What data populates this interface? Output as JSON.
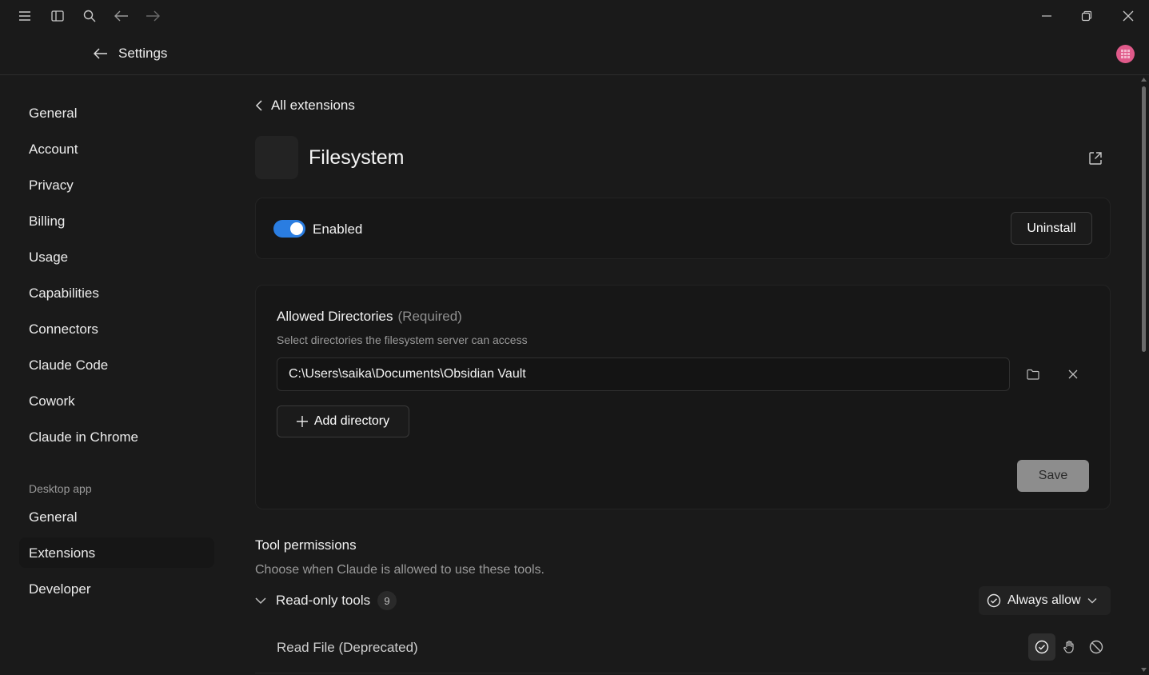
{
  "header": {
    "title": "Settings"
  },
  "sidebar": {
    "items": [
      {
        "label": "General"
      },
      {
        "label": "Account"
      },
      {
        "label": "Privacy"
      },
      {
        "label": "Billing"
      },
      {
        "label": "Usage"
      },
      {
        "label": "Capabilities"
      },
      {
        "label": "Connectors"
      },
      {
        "label": "Claude Code"
      },
      {
        "label": "Cowork"
      },
      {
        "label": "Claude in Chrome"
      }
    ],
    "section_heading": "Desktop app",
    "desktop_items": [
      {
        "label": "General"
      },
      {
        "label": "Extensions",
        "active": true
      },
      {
        "label": "Developer"
      }
    ]
  },
  "extension": {
    "back_label": "All extensions",
    "name": "Filesystem",
    "enabled_label": "Enabled",
    "enabled": true,
    "uninstall_label": "Uninstall"
  },
  "directories": {
    "title": "Allowed Directories",
    "required_tag": "(Required)",
    "description": "Select directories the filesystem server can access",
    "path_value": "C:\\Users\\saika\\Documents\\Obsidian Vault",
    "add_label": "Add directory",
    "save_label": "Save"
  },
  "tools": {
    "title": "Tool permissions",
    "description": "Choose when Claude is allowed to use these tools.",
    "group_label": "Read-only tools",
    "group_count": "9",
    "group_permission": "Always allow",
    "first_tool": "Read File (Deprecated)"
  },
  "colors": {
    "background": "#1a1a1a",
    "accent": "#2a7de1",
    "avatar": "#e05a8a"
  }
}
